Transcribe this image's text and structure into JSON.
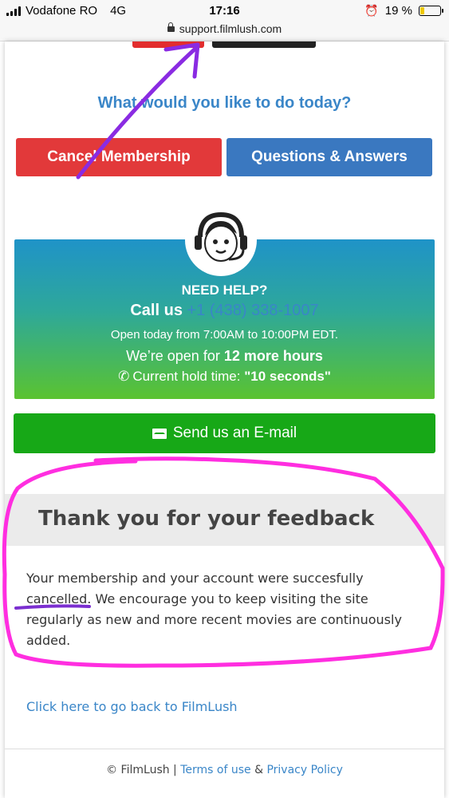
{
  "status_bar": {
    "carrier": "Vodafone RO",
    "network": "4G",
    "time": "17:16",
    "battery": "19 %",
    "battery_level": 0.19
  },
  "browser": {
    "url": "support.filmlush.com"
  },
  "page": {
    "headline": "What would you like to do today?",
    "buttons": {
      "cancel": "Cancel Membership",
      "qa": "Questions & Answers",
      "email": "Send us an E-mail"
    },
    "help": {
      "title": "NEED HELP?",
      "call_label": "Call us",
      "phone": "+1 (438) 338-1007",
      "hours": "Open today from 7:00AM to 10:00PM EDT.",
      "open_prefix": "We’re open for",
      "open_hours": "12 more hours",
      "hold_prefix": "Current hold time:",
      "hold_value": "\"10 seconds\""
    },
    "feedback": {
      "title": "Thank you for your feedback",
      "body": "Your membership and your account were succesfully cancelled. We encourage you to keep visiting the site regularly as new and more recent movies are continuously added."
    },
    "back_link": "Click here to go back to FilmLush",
    "footer": {
      "copyright": "© FilmLush |",
      "terms": "Terms of use",
      "amp": "&",
      "privacy": "Privacy Policy"
    }
  },
  "colors": {
    "accent_blue": "#3a86c8",
    "cancel_red": "#e2393a",
    "qa_blue": "#3a78c0",
    "email_green": "#17a817",
    "annotation_magenta": "#ff2ee0",
    "annotation_purple": "#8a2be2"
  }
}
